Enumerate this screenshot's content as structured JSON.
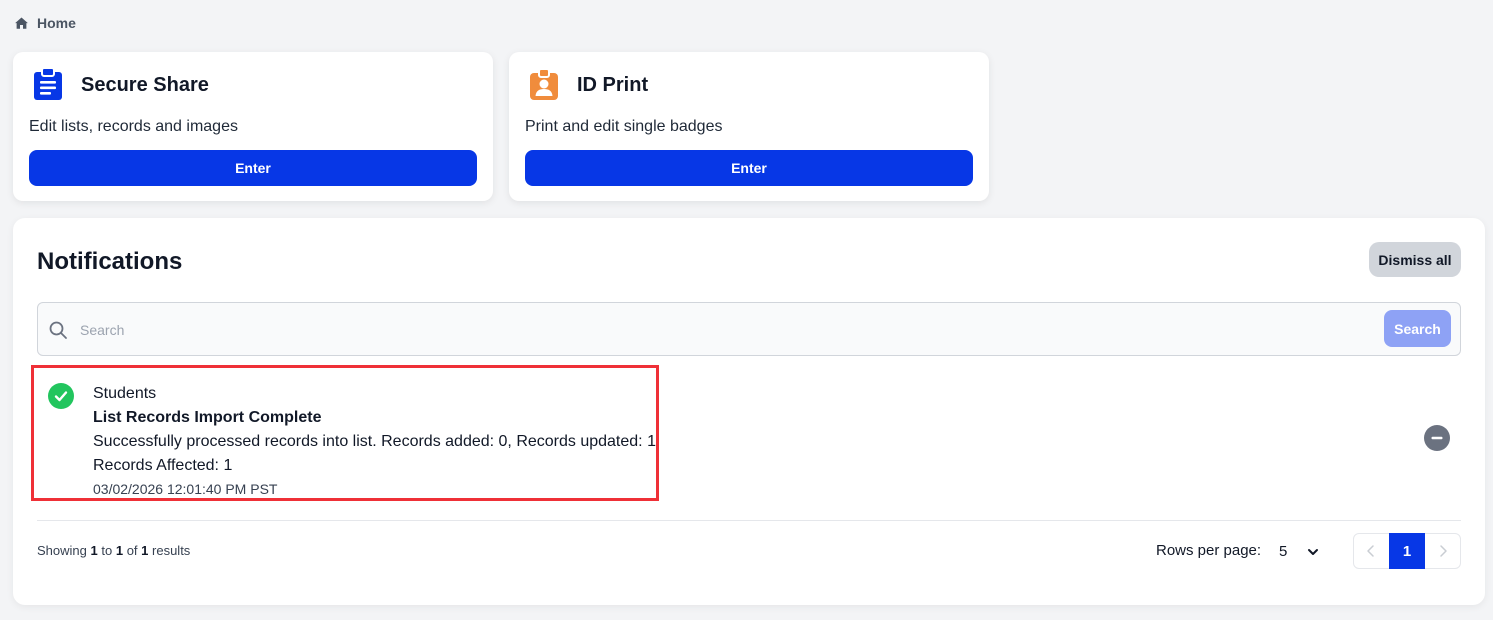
{
  "breadcrumb": {
    "icon": "home-icon",
    "label": "Home"
  },
  "apps": [
    {
      "icon": "clipboard-list-icon",
      "title": "Secure Share",
      "description": "Edit lists, records and images",
      "button_label": "Enter",
      "icon_color": "#0737e6"
    },
    {
      "icon": "id-badge-icon",
      "title": "ID Print",
      "description": "Print and edit single badges",
      "button_label": "Enter",
      "icon_color": "#f08c3c"
    }
  ],
  "notifications": {
    "title": "Notifications",
    "dismiss_all_label": "Dismiss all",
    "search": {
      "placeholder": "Search",
      "value": "",
      "button_label": "Search"
    },
    "items": [
      {
        "status": "success",
        "status_icon": "check-circle-icon",
        "list_name": "Students",
        "title": "List Records Import Complete",
        "message": "Successfully processed records into list. Records added: 0, Records updated: 1",
        "affected": "Records Affected: 1",
        "timestamp": "03/02/2026 12:01:40 PM PST"
      }
    ],
    "footer": {
      "showing_prefix": "Showing",
      "from": "1",
      "to_word": "to",
      "to": "1",
      "of_word": "of",
      "total": "1",
      "results_word": "results",
      "rows_per_page_label": "Rows per page:",
      "rows_per_page_value": "5",
      "current_page": "1"
    }
  },
  "colors": {
    "primary": "#0737e6",
    "success": "#22c55e",
    "highlight": "#ef3037"
  }
}
